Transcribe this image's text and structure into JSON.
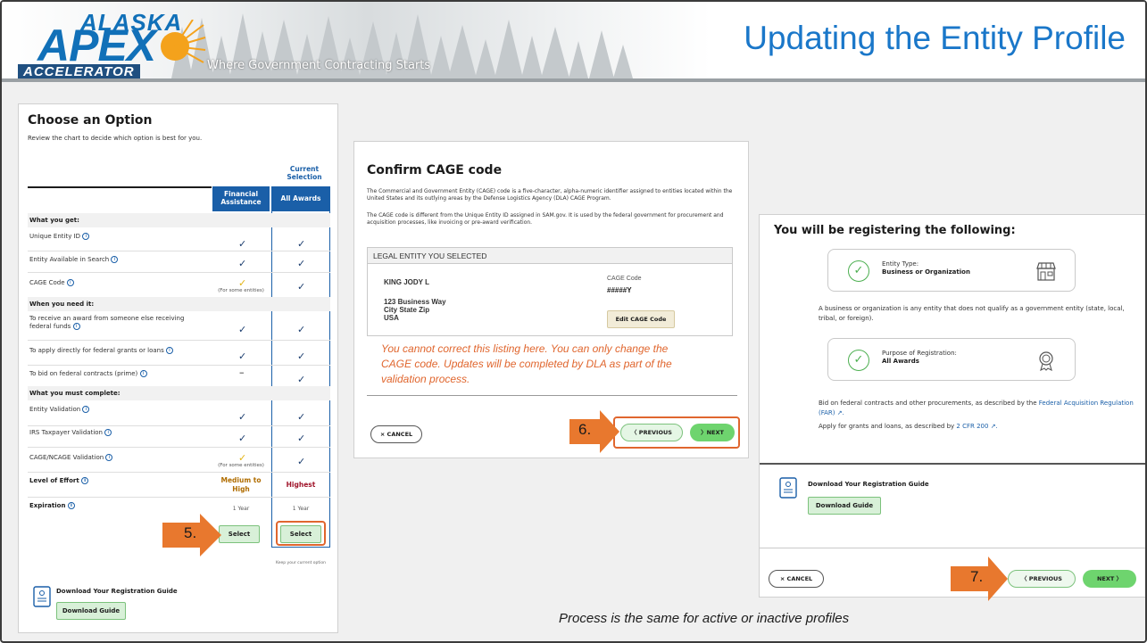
{
  "header": {
    "logo_top": "ALASKA",
    "logo_main": "APEX",
    "logo_bottom": "ACCELERATOR",
    "tagline": "Where Government Contracting Starts",
    "title": "Updating the Entity Profile"
  },
  "choose_panel": {
    "title": "Choose an Option",
    "subtitle": "Review the chart to decide which option is best for you.",
    "current_selection": "Current Selection",
    "col_financial": "Financial Assistance",
    "col_all": "All Awards",
    "sections": {
      "get": "What you get:",
      "need": "When you need it:",
      "complete": "What you must complete:"
    },
    "rows": {
      "uei": "Unique Entity ID",
      "search": "Entity Available in Search",
      "cage": "CAGE Code",
      "receive": "To receive an award from someone else receiving federal funds",
      "apply": "To apply directly for federal grants or loans",
      "bid": "To bid on federal contracts (prime)",
      "validation": "Entity Validation",
      "irs": "IRS Taxpayer Validation",
      "ncage": "CAGE/NCAGE Validation",
      "effort": "Level of Effort",
      "expiration": "Expiration"
    },
    "some_entities": "(For some entities)",
    "effort_financial": "Medium to High",
    "effort_all": "Highest",
    "exp_financial": "1 Year",
    "exp_all": "1 Year",
    "select_label": "Select",
    "keep_note": "Keep your current option",
    "download_title": "Download Your Registration Guide",
    "download_btn": "Download Guide"
  },
  "cage_panel": {
    "title": "Confirm CAGE code",
    "para1": "The Commercial and Government Entity (CAGE) code is a five-character, alpha-numeric identifier assigned to entities located within the United States and its outlying areas by the Defense Logistics Agency (DLA) CAGE Program.",
    "para2": "The CAGE code is different from the Unique Entity ID assigned in SAM.gov. It is used by the federal government for procurement and acquisition processes, like invoicing or pre-award verification.",
    "entity_header": "LEGAL ENTITY YOU SELECTED",
    "entity_name": "KING JODY L",
    "address1": "123 Business Way",
    "address2": "City State Zip",
    "address3": "USA",
    "cage_label": "CAGE Code",
    "cage_value": "#####Y",
    "edit_btn": "Edit CAGE Code",
    "warning": "You cannot correct this listing here. You can only change the CAGE code. Updates will be completed by DLA as part of the validation process.",
    "cancel": "× CANCEL",
    "previous": "〈 PREVIOUS",
    "next": "〉NEXT"
  },
  "register_panel": {
    "title": "You will be registering the following:",
    "entity_type_label": "Entity Type:",
    "entity_type_value": "Business or Organization",
    "desc": "A business or organization is any entity that does not qualify as a government entity (state, local, tribal, or foreign).",
    "purpose_label": "Purpose of Registration:",
    "purpose_value": "All Awards",
    "bid_text": "Bid on federal contracts and other procurements, as described by the ",
    "bid_link": "Federal Acquisition Regulation (FAR) ↗.",
    "apply_text": "Apply for grants and loans, as described by ",
    "apply_link": "2 CFR 200 ↗.",
    "download_title": "Download Your Registration Guide",
    "download_btn": "Download Guide",
    "cancel": "× CANCEL",
    "previous": "〈   PREVIOUS",
    "next": "NEXT  〉"
  },
  "steps": {
    "s5": "5.",
    "s6": "6.",
    "s7": "7."
  },
  "footer_note": "Process is the same for active or inactive profiles",
  "colors": {
    "accent": "#1a5fa8",
    "step_orange": "#e8782e",
    "warning": "#e0662e",
    "title_blue": "#1a77c9"
  }
}
